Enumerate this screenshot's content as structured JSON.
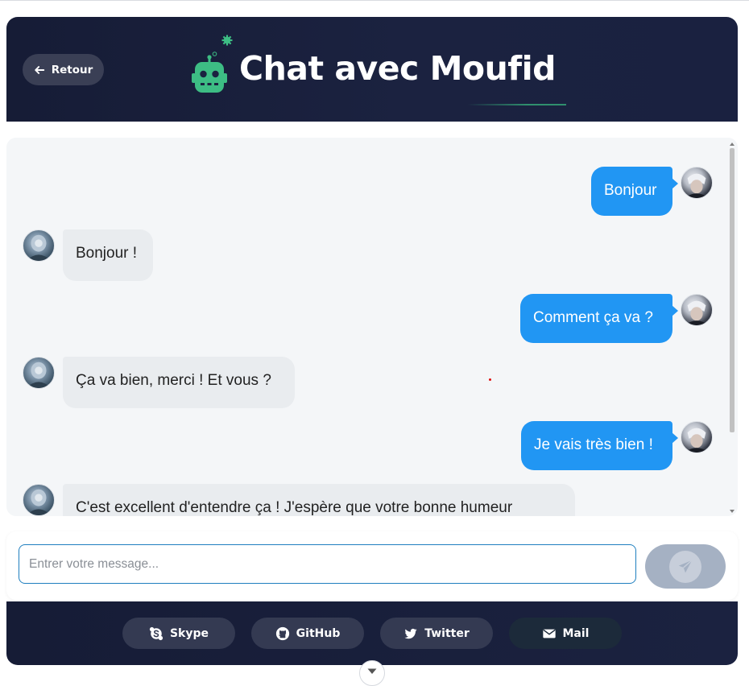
{
  "header": {
    "back_label": "Retour",
    "title": "Chat avec Moufid",
    "accent_color": "#3dbd84",
    "icons": {
      "back": "arrow-left-icon",
      "logo": "robot-icon",
      "gear": "gear-icon"
    }
  },
  "chat": {
    "messages": [
      {
        "sender": "user",
        "text": "Bonjour"
      },
      {
        "sender": "bot",
        "text": "Bonjour !"
      },
      {
        "sender": "user",
        "text": "Comment ça va ?"
      },
      {
        "sender": "bot",
        "text": "Ça va bien, merci ! Et vous ?"
      },
      {
        "sender": "user",
        "text": "Je vais très bien !"
      },
      {
        "sender": "bot",
        "text": "C'est excellent d'entendre ça ! J'espère que votre bonne humeur"
      }
    ],
    "user_bubble_color": "#2196f3",
    "bot_bubble_color": "#e9ecef"
  },
  "composer": {
    "placeholder": "Entrer votre message...",
    "value": "",
    "send_icon": "paper-plane-icon"
  },
  "footer": {
    "links": [
      {
        "label": "Skype",
        "icon": "skype-icon"
      },
      {
        "label": "GitHub",
        "icon": "github-icon"
      },
      {
        "label": "Twitter",
        "icon": "twitter-icon"
      },
      {
        "label": "Mail",
        "icon": "envelope-icon"
      }
    ]
  }
}
